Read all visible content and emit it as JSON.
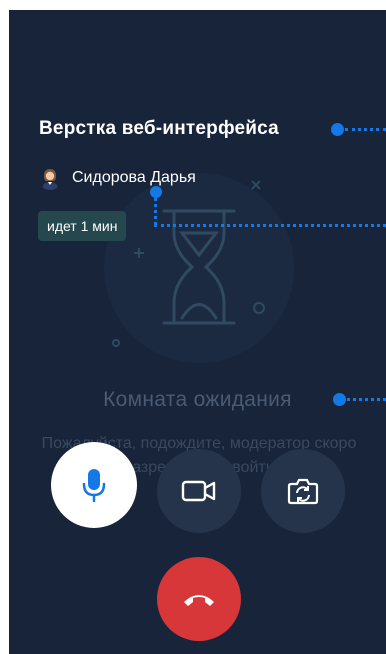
{
  "meeting": {
    "title": "Верстка веб-интерфейса",
    "organizer": "Сидорова Дарья",
    "duration": "идет 1 мин"
  },
  "waiting_room": {
    "title": "Комната ожидания",
    "message": "Пожалуйста, подождите, модератор скоро разрешит вам войти"
  },
  "controls": {
    "mic": "microphone-icon",
    "camera": "video-camera-icon",
    "switch_camera": "switch-camera-icon",
    "end_call": "hang-up-icon"
  },
  "colors": {
    "background": "#17243a",
    "accent": "#1479e6",
    "end_call": "#d8373a",
    "badge": "#25484e"
  }
}
